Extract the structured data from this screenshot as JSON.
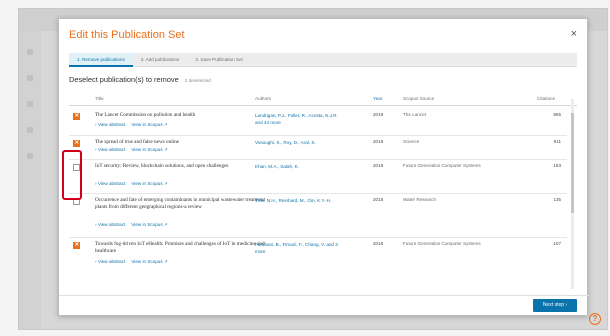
{
  "modal": {
    "title": "Edit this Publication Set",
    "close_label": "×"
  },
  "steps": [
    {
      "label": "1. Remove publications",
      "active": true
    },
    {
      "label": "2. Add publications",
      "active": false
    },
    {
      "label": "3. Save Publication Set",
      "active": false
    }
  ],
  "subtitle": {
    "text": "Deselect publication(s) to remove",
    "count": "2 deselected"
  },
  "columns": {
    "title": "Title",
    "authors": "Authors",
    "year": "Year",
    "source": "Scopus Source",
    "citations": "Citations"
  },
  "links": {
    "abstract": "View abstract",
    "scopus": "View in Scopus"
  },
  "publications": [
    {
      "title": "The Lancet Commission on pollution and health",
      "authors": "Landrigan, P.J., Fuller, R., Acosta, N.J.R. and 44 more",
      "year": "2018",
      "source": "The Lancet",
      "citations": "955",
      "checked": true
    },
    {
      "title": "The spread of true and false news online",
      "authors": "Vosoughi, S., Roy, D., Aral, S.",
      "year": "2018",
      "source": "Science",
      "citations": "911",
      "checked": true
    },
    {
      "title": "IoT security: Review, blockchain solutions, and open challenges",
      "authors": "Khan, M.A., Salah, K.",
      "year": "2018",
      "source": "Future Generation Computer Systems",
      "citations": "183",
      "checked": false
    },
    {
      "title": "Occurrence and fate of emerging contaminants in municipal wastewater treatment plants from different geographical regions-a review",
      "authors": "Tran, N.H., Reinhard, M., Gin, K.Y.-H.",
      "year": "2018",
      "source": "Water Research",
      "citations": "135",
      "checked": false
    },
    {
      "title": "Towards fog-driven IoT eHealth: Promises and challenges of IoT in medicine and healthcare",
      "authors": "Farahani, B., Firouzi, F., Chang, V. and 3 more",
      "year": "2018",
      "source": "Future Generation Computer Systems",
      "citations": "107",
      "checked": true
    }
  ],
  "footer": {
    "next_label": "Next step ›"
  },
  "colors": {
    "accent": "#e9711c",
    "link": "#0b73ab",
    "highlight": "#d0021b"
  },
  "icons": [
    "close-icon",
    "checkbox-icon",
    "chevron-right-icon",
    "help-icon"
  ]
}
